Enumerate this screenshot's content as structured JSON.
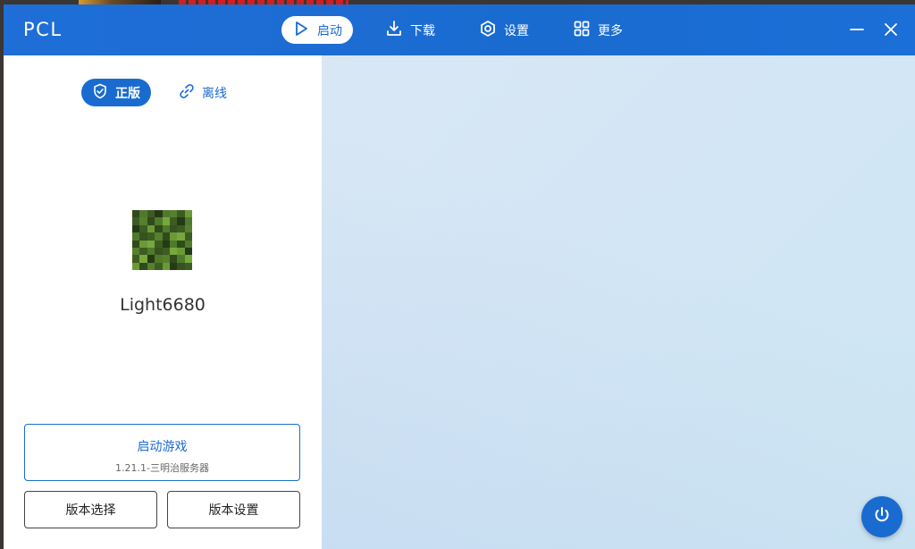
{
  "app": {
    "title": "PCL",
    "accent_color": "#1a6bd0"
  },
  "nav": {
    "items": [
      {
        "label": "启动",
        "icon": "play-icon",
        "active": true
      },
      {
        "label": "下载",
        "icon": "download-icon",
        "active": false
      },
      {
        "label": "设置",
        "icon": "gear-icon",
        "active": false
      },
      {
        "label": "更多",
        "icon": "grid-icon",
        "active": false
      }
    ]
  },
  "window_controls": {
    "minimize_icon": "minimize-icon",
    "close_icon": "close-icon"
  },
  "sidebar": {
    "mode_tabs": [
      {
        "label": "正版",
        "icon": "shield-check-icon",
        "active": true
      },
      {
        "label": "离线",
        "icon": "link-icon",
        "active": false
      }
    ],
    "avatar": {
      "icon": "player-skin-avatar"
    },
    "username": "Light6680",
    "launch": {
      "title": "启动游戏",
      "subtitle": "1.21.1-三明治服务器"
    },
    "version_select_label": "版本选择",
    "version_settings_label": "版本设置"
  },
  "main": {
    "power_icon": "power-icon"
  }
}
